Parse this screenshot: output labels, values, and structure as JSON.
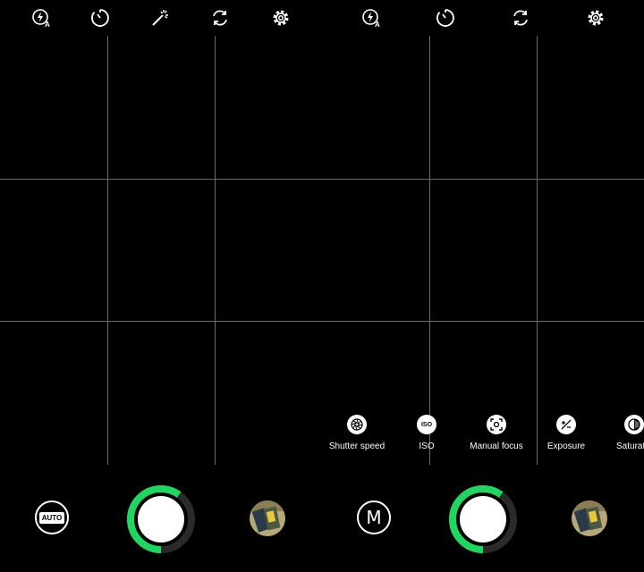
{
  "left_panel": {
    "top_icons": [
      "flash-auto-icon",
      "timer-icon",
      "magic-wand-icon",
      "switch-camera-icon",
      "settings-icon"
    ],
    "mode_badge": "AUTO",
    "shutter_progress": 0.6,
    "gallery_thumbnail": "gallery-thumbnail"
  },
  "right_panel": {
    "top_icons": [
      "flash-auto-icon",
      "timer-icon",
      "switch-camera-icon",
      "settings-icon"
    ],
    "mode_letter": "M",
    "shutter_progress": 0.6,
    "manual_controls": [
      {
        "label": "Shutter speed",
        "icon": "aperture-icon"
      },
      {
        "label": "ISO",
        "icon": "iso-icon",
        "badge": "ISO"
      },
      {
        "label": "Manual focus",
        "icon": "focus-icon"
      },
      {
        "label": "Exposure",
        "icon": "exposure-icon"
      },
      {
        "label": "Saturation",
        "icon": "saturation-icon"
      }
    ]
  },
  "colors": {
    "background": "#000000",
    "grid_line": "#6a6a6a",
    "shutter_accent": "#1ed760",
    "shutter_track": "#2a2a2a"
  }
}
